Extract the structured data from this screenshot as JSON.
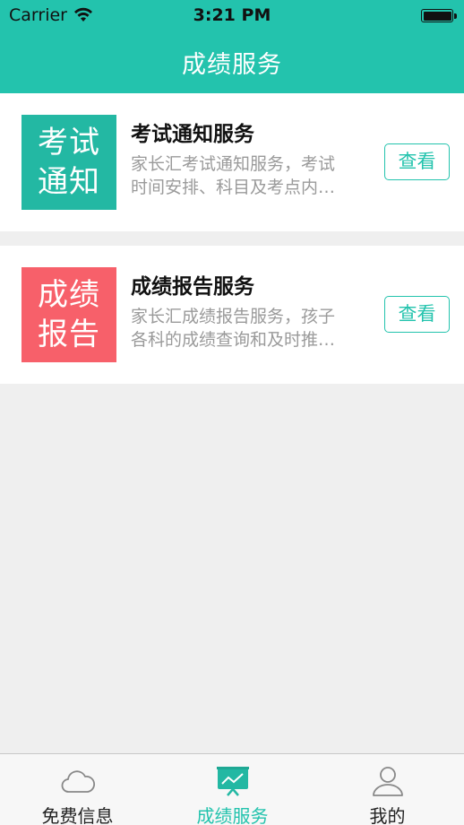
{
  "status_bar": {
    "carrier": "Carrier",
    "time": "3:21 PM"
  },
  "nav": {
    "title": "成绩服务"
  },
  "services": [
    {
      "thumb_line1": "考试",
      "thumb_line2": "通知",
      "thumb_color": "#23b8a3",
      "title": "考试通知服务",
      "desc_line1": "家长汇考试通知服务，考试",
      "desc_line2": "时间安排、科目及考点内…",
      "button": "查看"
    },
    {
      "thumb_line1": "成绩",
      "thumb_line2": "报告",
      "thumb_color": "#f7606a",
      "title": "成绩报告服务",
      "desc_line1": "家长汇成绩报告服务，孩子",
      "desc_line2": "各科的成绩查询和及时推…",
      "button": "查看"
    }
  ],
  "tabbar": {
    "tabs": [
      {
        "label": "免费信息",
        "icon": "cloud-icon",
        "active": false
      },
      {
        "label": "成绩服务",
        "icon": "chart-board-icon",
        "active": true
      },
      {
        "label": "我的",
        "icon": "user-icon",
        "active": false
      }
    ]
  },
  "colors": {
    "accent": "#23c3ad",
    "background": "#efefef"
  }
}
